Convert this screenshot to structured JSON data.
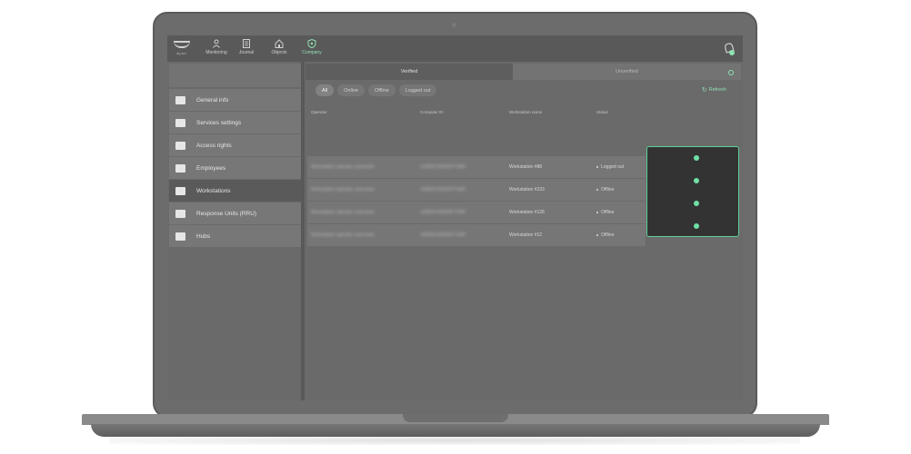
{
  "logo": {
    "text": "ajax"
  },
  "nav": [
    {
      "label": "Monitoring",
      "icon": "person-icon"
    },
    {
      "label": "Journal",
      "icon": "journal-icon"
    },
    {
      "label": "Objects",
      "icon": "home-icon"
    },
    {
      "label": "Company",
      "icon": "shield-icon",
      "active": true
    }
  ],
  "sidebar": {
    "items": [
      {
        "label": "General info",
        "icon": "clipboard-icon"
      },
      {
        "label": "Services settings",
        "icon": "star-icon"
      },
      {
        "label": "Access rights",
        "icon": "id-card-icon"
      },
      {
        "label": "Employees",
        "icon": "id-card-icon"
      },
      {
        "label": "Workstations",
        "icon": "monitor-icon",
        "active": true
      },
      {
        "label": "Response Units (RRU)",
        "icon": "car-icon"
      },
      {
        "label": "Hubs",
        "icon": "plus-box-icon"
      }
    ]
  },
  "tabs": {
    "verified": "Verified",
    "unverified": "Unverified"
  },
  "filters": [
    "All",
    "Online",
    "Offline",
    "Logged out"
  ],
  "refresh_label": "Refresh",
  "table": {
    "headers": [
      "Operator",
      "Computer ID",
      "Workstation name",
      "Status"
    ],
    "rows": [
      {
        "operator": "Workstation operator username",
        "computer_id": "1A2B3C4D5E6F7G8H",
        "workstation": "Workstation #88",
        "status": "Logged out"
      },
      {
        "operator": "Workstation operator username",
        "computer_id": "1A2B3C4D5E6F7G8H",
        "workstation": "Workstation #233",
        "status": "Offline"
      },
      {
        "operator": "Workstation operator username",
        "computer_id": "1A2B3C4D5E6F7G8H",
        "workstation": "Workstation #128",
        "status": "Offline"
      },
      {
        "operator": "Workstation operator username",
        "computer_id": "1A2B3C4D5E6F7G8H",
        "workstation": "Workstation #12",
        "status": "Offline"
      }
    ]
  },
  "colors": {
    "accent": "#8fe0b0",
    "highlight_dot": "#6fe0a6",
    "highlight_border": "#5fd19a"
  }
}
